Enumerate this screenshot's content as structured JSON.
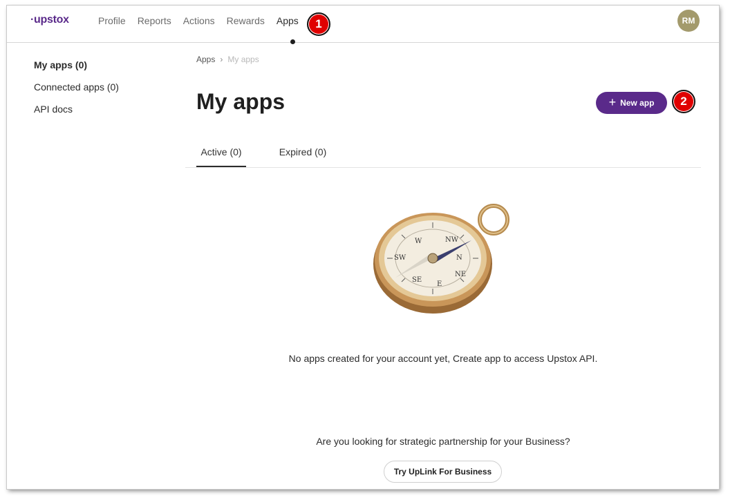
{
  "brand": {
    "logo_text": "·upstox",
    "accent_color": "#5a2a8a"
  },
  "nav": {
    "items": [
      {
        "label": "Profile",
        "active": false
      },
      {
        "label": "Reports",
        "active": false
      },
      {
        "label": "Actions",
        "active": false
      },
      {
        "label": "Rewards",
        "active": false
      },
      {
        "label": "Apps",
        "active": true
      }
    ],
    "avatar_initials": "RM",
    "avatar_color": "#a39a6c"
  },
  "annotations": {
    "badge_1": "1",
    "badge_2": "2",
    "badge_color": "#e00000"
  },
  "sidebar": {
    "items": [
      {
        "label": "My apps (0)",
        "active": true
      },
      {
        "label": "Connected apps (0)",
        "active": false
      },
      {
        "label": "API docs",
        "active": false
      }
    ]
  },
  "breadcrumb": {
    "root": "Apps",
    "separator": "›",
    "current": "My apps"
  },
  "main": {
    "title": "My apps",
    "new_app_label": "New app",
    "new_app_icon": "plus-icon",
    "tabs": [
      {
        "label": "Active (0)",
        "active": true
      },
      {
        "label": "Expired (0)",
        "active": false
      }
    ],
    "illustration": "compass-icon",
    "empty_message": "No apps created for your account yet, Create app to access Upstox API.",
    "partnership_text": "Are you looking for strategic partnership for your Business?",
    "partnership_button": "Try UpLink For Business"
  }
}
